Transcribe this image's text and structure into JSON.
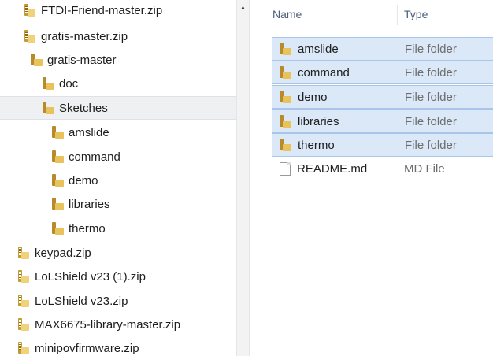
{
  "nav": {
    "items": [
      {
        "label": "FTDI-Friend-master.zip",
        "icon": "zip-folder-icon"
      },
      {
        "label": "gratis-master.zip",
        "icon": "zip-folder-icon"
      },
      {
        "label": "gratis-master",
        "icon": "folder-icon"
      },
      {
        "label": "doc",
        "icon": "folder-icon"
      },
      {
        "label": "Sketches",
        "icon": "folder-icon",
        "selected": true
      },
      {
        "label": "amslide",
        "icon": "folder-icon"
      },
      {
        "label": "command",
        "icon": "folder-icon"
      },
      {
        "label": "demo",
        "icon": "folder-icon"
      },
      {
        "label": "libraries",
        "icon": "folder-icon"
      },
      {
        "label": "thermo",
        "icon": "folder-icon"
      },
      {
        "label": "keypad.zip",
        "icon": "zip-folder-icon"
      },
      {
        "label": "LoLShield v23 (1).zip",
        "icon": "zip-folder-icon"
      },
      {
        "label": "LoLShield v23.zip",
        "icon": "zip-folder-icon"
      },
      {
        "label": "MAX6675-library-master.zip",
        "icon": "zip-folder-icon"
      },
      {
        "label": "minipovfirmware.zip",
        "icon": "zip-folder-icon"
      }
    ]
  },
  "scrollbar": {
    "up_arrow": "▲"
  },
  "content": {
    "columns": {
      "name": "Name",
      "type": "Type"
    },
    "files": [
      {
        "name": "amslide",
        "type": "File folder",
        "icon": "folder-icon",
        "selected": true
      },
      {
        "name": "command",
        "type": "File folder",
        "icon": "folder-icon",
        "selected": true
      },
      {
        "name": "demo",
        "type": "File folder",
        "icon": "folder-icon",
        "selected": true
      },
      {
        "name": "libraries",
        "type": "File folder",
        "icon": "folder-icon",
        "selected": true
      },
      {
        "name": "thermo",
        "type": "File folder",
        "icon": "folder-icon",
        "selected": true
      },
      {
        "name": "README.md",
        "type": "MD File",
        "icon": "document-icon",
        "selected": false
      }
    ]
  }
}
